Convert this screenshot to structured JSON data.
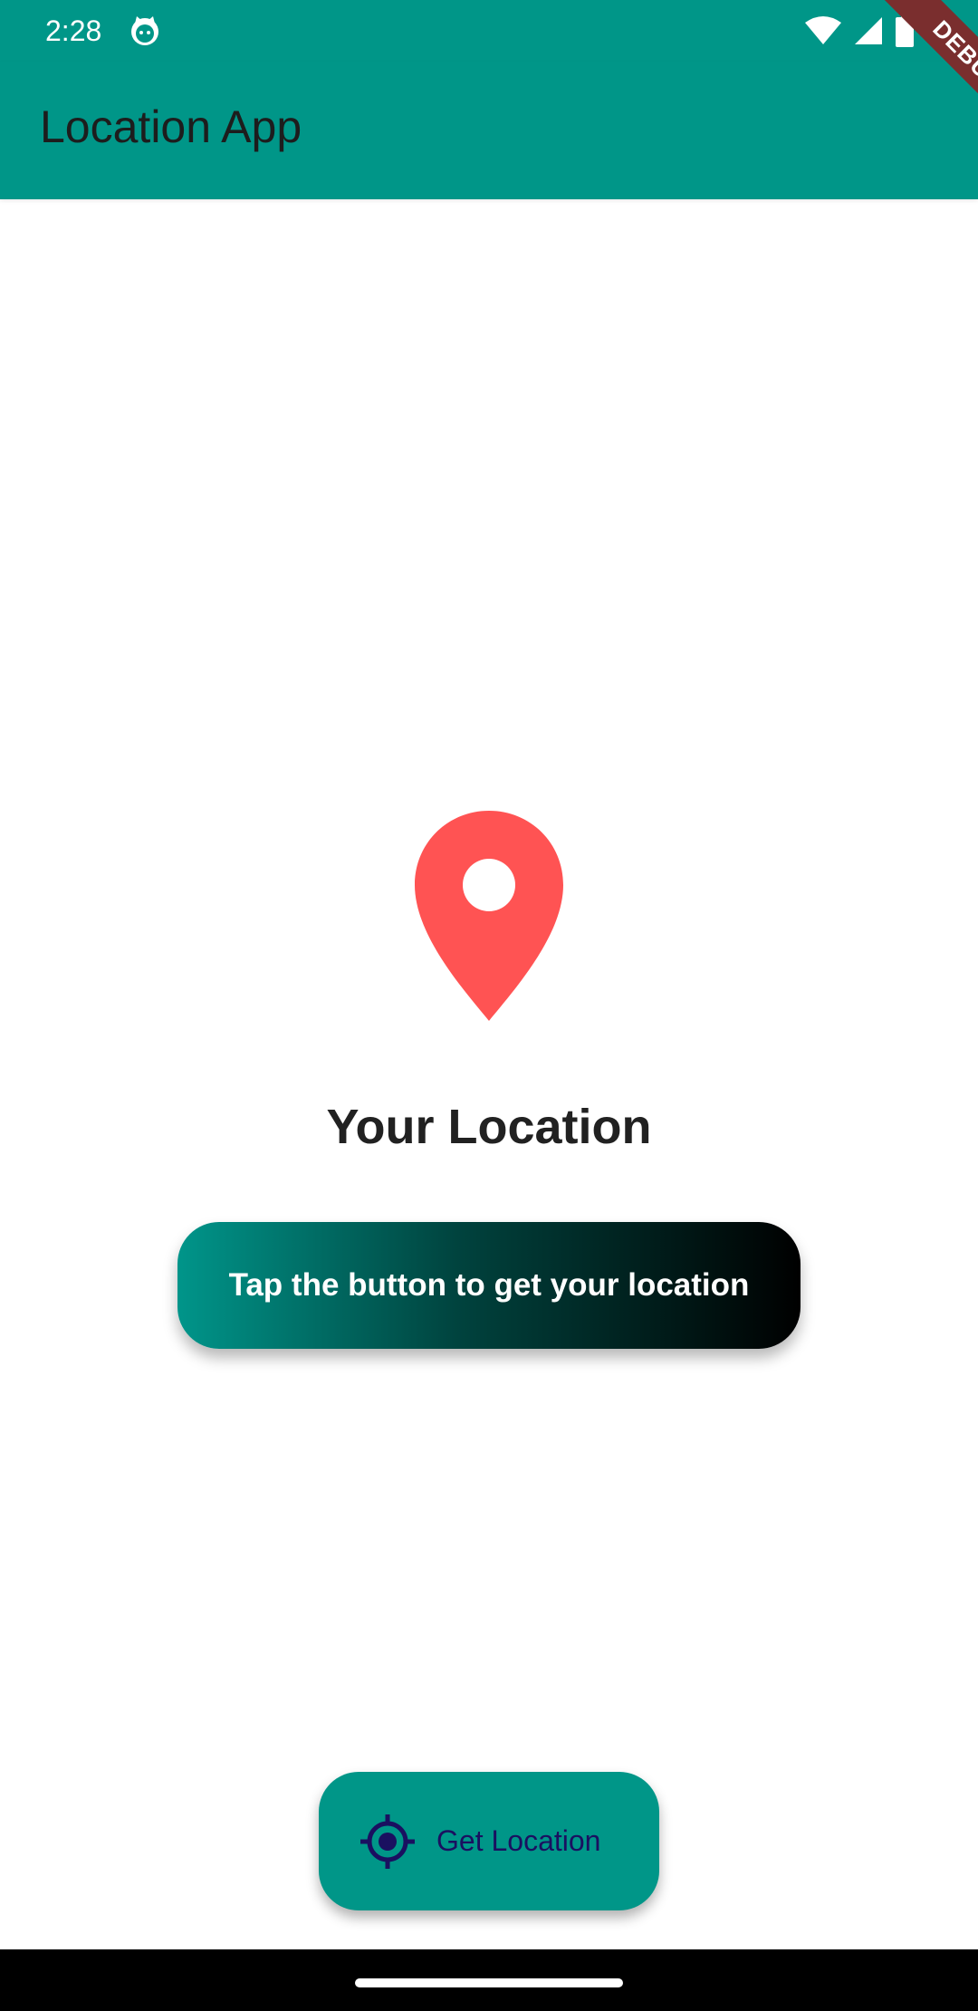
{
  "status_bar": {
    "time": "2:28",
    "icons": [
      "cat-notification-icon",
      "wifi-icon",
      "signal-icon",
      "battery-icon"
    ]
  },
  "app_bar": {
    "title": "Location App",
    "color": "#009688"
  },
  "debug_banner": {
    "label": "DEBUG"
  },
  "main": {
    "pin_color": "#FF5353",
    "heading": "Your Location",
    "info_text": "Tap the button to get your location"
  },
  "fab": {
    "label": "Get Location",
    "icon": "gps-fixed-icon"
  }
}
